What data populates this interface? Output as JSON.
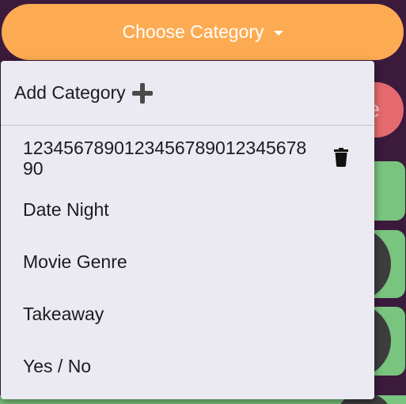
{
  "select": {
    "label": "Choose Category"
  },
  "background": {
    "partial_button_text": "e"
  },
  "menu": {
    "add_label": "Add Category",
    "items": [
      {
        "label": "1234567890123456789012345678 90"
      },
      {
        "label": "Date Night"
      },
      {
        "label": "Movie Genre"
      },
      {
        "label": "Takeaway"
      },
      {
        "label": "Yes / No"
      }
    ]
  },
  "colors": {
    "background": "#3b1a3c",
    "select_button": "#fdab52",
    "menu_surface": "#ebe9f1",
    "bg_red_button": "#e46a6f",
    "bg_card_green": "#79c47f"
  },
  "icons": {
    "add": "plus-icon",
    "delete": "trash-icon",
    "dropdown": "caret-down-icon"
  }
}
